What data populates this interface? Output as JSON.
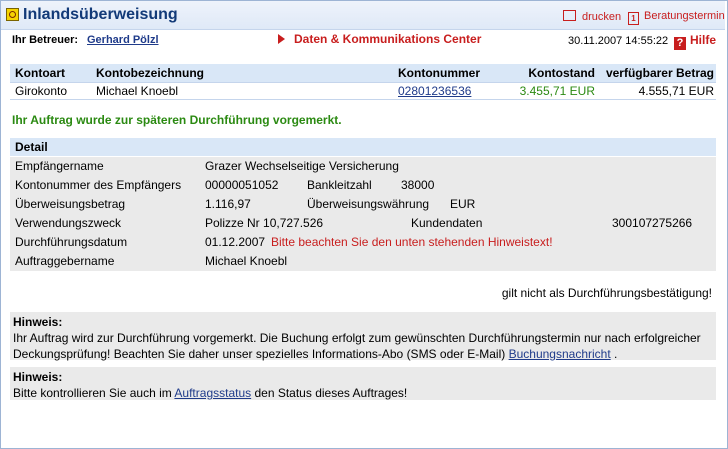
{
  "header": {
    "title": "Inlandsüberweisung",
    "print_label": "drucken",
    "appointment_label": "Beratungstermin",
    "advisor_label": "Ihr Betreuer:",
    "advisor_name": "Gerhard Pölzl",
    "center_label": "Daten & Kommunikations Center",
    "datetime": "30.11.2007 14:55:22",
    "help_label": "Hilfe"
  },
  "accounts": {
    "columns": [
      "Kontoart",
      "Kontobezeichnung",
      "Kontonummer",
      "Kontostand",
      "verfügbarer Betrag"
    ],
    "row": {
      "type": "Girokonto",
      "name": "Michael Knoebl",
      "number": "02801236536",
      "balance": "3.455,71 EUR",
      "available": "4.555,71 EUR"
    }
  },
  "confirmation": "Ihr Auftrag wurde zur späteren Durchführung vorgemerkt.",
  "detail": {
    "heading": "Detail",
    "recipient_label": "Empfängername",
    "recipient_value": "Grazer Wechselseitige Versicherung",
    "acct_label": "Kontonummer des Empfängers",
    "acct_value": "00000051052",
    "blz_label": "Bankleitzahl",
    "blz_value": "38000",
    "amount_label": "Überweisungsbetrag",
    "amount_value": "1.116,97",
    "currency_label": "Überweisungswährung",
    "currency_value": "EUR",
    "purpose_label": "Verwendungszweck",
    "purpose_value": "Polizze Nr 10,727.526",
    "customer_label": "Kundendaten",
    "customer_value": "300107275266",
    "exec_label": "Durchführungsdatum",
    "exec_value": "01.12.2007",
    "exec_note": "Bitte beachten Sie den unten stehenden Hinweistext!",
    "orderer_label": "Auftraggebername",
    "orderer_value": "Michael Knoebl"
  },
  "not_confirmation": "gilt nicht als Durchführungsbestätigung!",
  "notice1": {
    "heading": "Hinweis:",
    "line1": "Ihr Auftrag wird zur Durchführung vorgemerkt. Die Buchung erfolgt zum gewünschten Durchführungstermin nur nach erfolgreicher",
    "line2": "Deckungsprüfung! Beachten Sie daher unser spezielles Informations-Abo (SMS oder E-Mail)",
    "link": "Buchungsnachricht",
    "tail": "."
  },
  "notice2": {
    "heading": "Hinweis:",
    "pre": "Bitte kontrollieren Sie auch im",
    "link": "Auftragsstatus",
    "post": "den Status dieses Auftrages!"
  }
}
